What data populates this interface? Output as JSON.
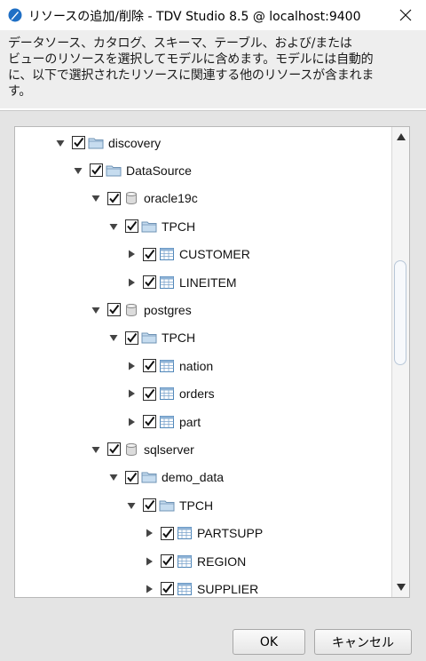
{
  "window": {
    "title": "リソースの追加/削除 - TDV Studio 8.5 @ localhost:9400"
  },
  "description": {
    "lines": [
      "データソース、カタログ、スキーマ、テーブル、および/または",
      "ビューのリソースを選択してモデルに含めます。モデルには自動的",
      "に、以下で選択されたリソースに関連する他のリソースが含まれま",
      "す。"
    ]
  },
  "tree": {
    "nodes": [
      {
        "label": "discovery",
        "type": "folder-icon",
        "expanded": true,
        "checked": true
      },
      {
        "label": "DataSource",
        "type": "folder-icon",
        "expanded": true,
        "checked": true
      },
      {
        "label": "oracle19c",
        "type": "database-icon",
        "expanded": true,
        "checked": true
      },
      {
        "label": "TPCH",
        "type": "folder-icon",
        "expanded": true,
        "checked": true
      },
      {
        "label": "CUSTOMER",
        "type": "table-icon",
        "expanded": false,
        "checked": true
      },
      {
        "label": "LINEITEM",
        "type": "table-icon",
        "expanded": false,
        "checked": true
      },
      {
        "label": "postgres",
        "type": "database-icon",
        "expanded": true,
        "checked": true
      },
      {
        "label": "TPCH",
        "type": "folder-icon",
        "expanded": true,
        "checked": true
      },
      {
        "label": "nation",
        "type": "table-icon",
        "expanded": false,
        "checked": true
      },
      {
        "label": "orders",
        "type": "table-icon",
        "expanded": false,
        "checked": true
      },
      {
        "label": "part",
        "type": "table-icon",
        "expanded": false,
        "checked": true
      },
      {
        "label": "sqlserver",
        "type": "database-icon",
        "expanded": true,
        "checked": true
      },
      {
        "label": "demo_data",
        "type": "folder-icon",
        "expanded": true,
        "checked": true
      },
      {
        "label": "TPCH",
        "type": "folder-icon",
        "expanded": true,
        "checked": true
      },
      {
        "label": "PARTSUPP",
        "type": "table-icon",
        "expanded": false,
        "checked": true
      },
      {
        "label": "REGION",
        "type": "table-icon",
        "expanded": false,
        "checked": true
      },
      {
        "label": "SUPPLIER",
        "type": "table-icon",
        "expanded": false,
        "checked": true
      }
    ]
  },
  "buttons": {
    "ok_label": "OK",
    "cancel_label": "キャンセル"
  },
  "colors": {
    "accent": "#2a7bd0",
    "folder": "#c6dcef",
    "table": "#4f86b8"
  }
}
